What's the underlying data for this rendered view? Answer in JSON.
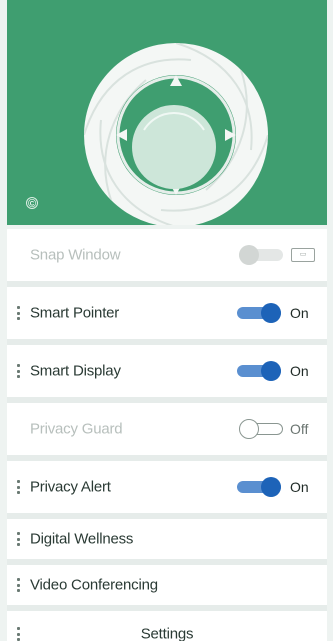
{
  "hero": {
    "logo_icon": "shutter-lens-icon",
    "copyright_symbol": "©",
    "accent_color": "#3f9e70"
  },
  "features": [
    {
      "label": "Snap Window",
      "state": "disabled",
      "status_icon": "unavailable-icon"
    },
    {
      "label": "Smart Pointer",
      "state": "on",
      "status_text": "On"
    },
    {
      "label": "Smart Display",
      "state": "on",
      "status_text": "On"
    },
    {
      "label": "Privacy Guard",
      "state": "off",
      "status_text": "Off"
    },
    {
      "label": "Privacy Alert",
      "state": "on",
      "status_text": "On"
    }
  ],
  "links": [
    {
      "label": "Digital Wellness"
    },
    {
      "label": "Video Conferencing"
    },
    {
      "label": "Settings"
    }
  ],
  "colors": {
    "toggle_on": "#1d63b8",
    "toggle_on_track": "#5a8fd0",
    "disabled_text": "#b7bfbc"
  }
}
